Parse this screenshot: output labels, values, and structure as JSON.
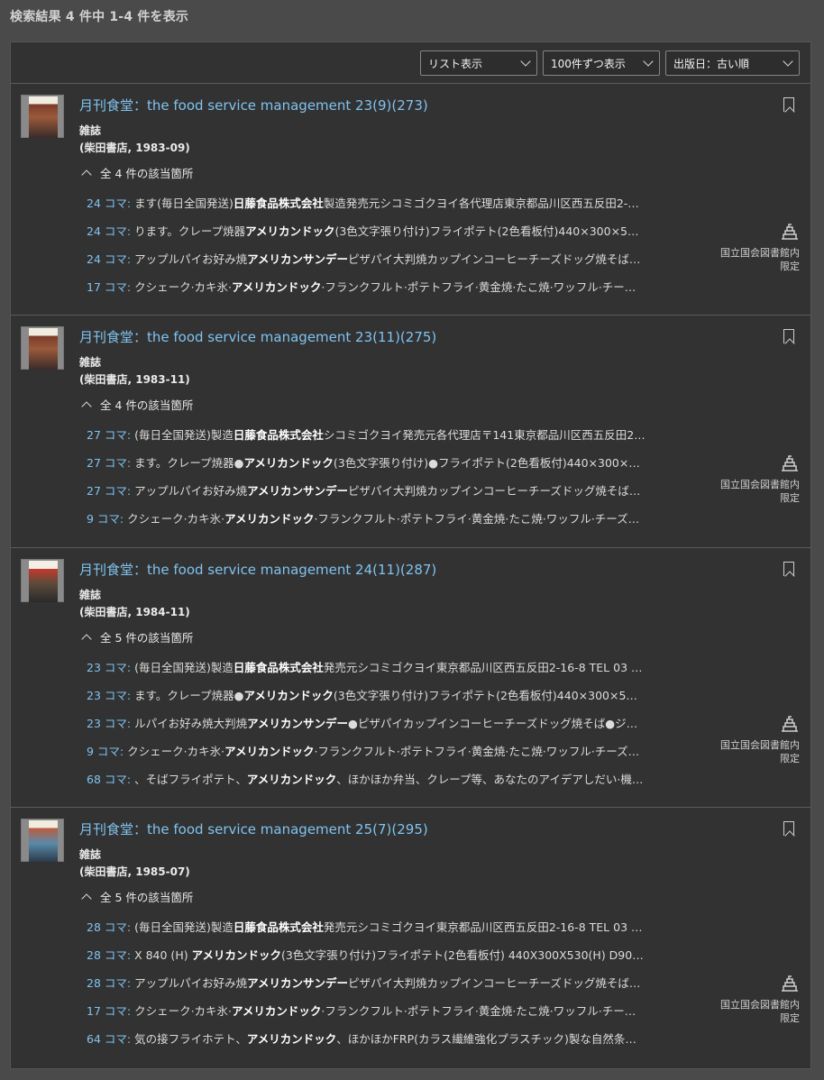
{
  "summary": "検索結果 4 件中 1-4 件を表示",
  "controls": {
    "view": "リスト表示",
    "per_page": "100件ずつ表示",
    "sort": "出版日：古い順"
  },
  "access_label_line1": "国立国会図書館内",
  "access_label_line2": "限定",
  "results": [
    {
      "title": "月刊食堂：the food service management 23(9)(273)",
      "type": "雑誌",
      "publisher": "(柴田書店, 1983-09)",
      "hits_label": "全 4 件の該当箇所",
      "hits": [
        {
          "koma": "24 コマ:",
          "pre": " ます(毎日全国発送)",
          "em": "日藤食品株式会社",
          "post": "製造発売元シコミゴクヨイ各代理店東京都品川区西五反田2-…"
        },
        {
          "koma": "24 コマ:",
          "pre": " ります。クレープ焼器",
          "em": "アメリカンドック",
          "post": "(3色文字張り付け)フライポテト(2色看板付)440×300×5…"
        },
        {
          "koma": "24 コマ:",
          "pre": " アップルパイお好み焼",
          "em": "アメリカンサンデー",
          "post": "ピザパイ大判焼カップインコーヒーチーズドッグ焼そば…"
        },
        {
          "koma": "17 コマ:",
          "pre": " クシェーク·カキ氷·",
          "em": "アメリカンドック",
          "post": "·フランクフルト·ポテトフライ·黄金焼·たこ焼·ワッフル·チー…"
        }
      ]
    },
    {
      "title": "月刊食堂：the food service management 23(11)(275)",
      "type": "雑誌",
      "publisher": "(柴田書店, 1983-11)",
      "hits_label": "全 4 件の該当箇所",
      "hits": [
        {
          "koma": "27 コマ:",
          "pre": " (毎日全国発送)製造",
          "em": "日藤食品株式会社",
          "post": "シコミゴクヨイ発売元各代理店〒141東京都品川区西五反田2…"
        },
        {
          "koma": "27 コマ:",
          "pre": " ます。クレープ焼器●",
          "em": "アメリカンドック",
          "post": "(3色文字張り付け)●フライポテト(2色看板付)440×300×…"
        },
        {
          "koma": "27 コマ:",
          "pre": " アップルパイお好み焼",
          "em": "アメリカンサンデー",
          "post": "ピザパイ大判焼カップインコーヒーチーズドッグ焼そば…"
        },
        {
          "koma": "9 コマ:",
          "pre": " クシェーク·カキ氷·",
          "em": "アメリカンドック",
          "post": "·フランクフルト·ポテトフライ·黄金焼·たこ焼·ワッフル·チーズ…"
        }
      ]
    },
    {
      "title": "月刊食堂：the food service management 24(11)(287)",
      "type": "雑誌",
      "publisher": "(柴田書店, 1984-11)",
      "hits_label": "全 5 件の該当箇所",
      "hits": [
        {
          "koma": "23 コマ:",
          "pre": " (毎日全国発送)製造",
          "em": "日藤食品株式会社",
          "post": "発売元シコミゴクヨイ東京都品川区西五反田2-16-8 TEL 03 …"
        },
        {
          "koma": "23 コマ:",
          "pre": " ます。クレープ焼器●",
          "em": "アメリカンドック",
          "post": "(3色文字張り付け)フライポテト(2色看板付)440×300×5…"
        },
        {
          "koma": "23 コマ:",
          "pre": " ルパイお好み焼大判焼",
          "em": "アメリカンサンデー",
          "post": "●ピザパイカップインコーヒーチーズドッグ焼そば●ジ…"
        },
        {
          "koma": "9 コマ:",
          "pre": " クシェーク·カキ氷·",
          "em": "アメリカンドック",
          "post": "·フランクフルト·ポテトフライ·黄金焼·たこ焼·ワッフル·チーズ…"
        },
        {
          "koma": "68 コマ:",
          "pre": " 、そばフライポテト、",
          "em": "アメリカンドック",
          "post": "、ほかほか弁当、クレープ等、あなたのアイデアしだい·機…"
        }
      ]
    },
    {
      "title": "月刊食堂：the food service management 25(7)(295)",
      "type": "雑誌",
      "publisher": "(柴田書店, 1985-07)",
      "hits_label": "全 5 件の該当箇所",
      "hits": [
        {
          "koma": "28 コマ:",
          "pre": " (毎日全国発送)製造",
          "em": "日藤食品株式会社",
          "post": "発売元シコミゴクヨイ東京都品川区西五反田2-16-8 TEL 03 …"
        },
        {
          "koma": "28 コマ:",
          "pre": " X 840 (H) ",
          "em": "アメリカンドック",
          "post": "(3色文字張り付け)フライポテト(2色看板付) 440X300X530(H) D90…"
        },
        {
          "koma": "28 コマ:",
          "pre": " アップルパイお好み焼",
          "em": "アメリカンサンデー",
          "post": "ピザパイ大判焼カップインコーヒーチーズドッグ焼そば…"
        },
        {
          "koma": "17 コマ:",
          "pre": " クシェーク·カキ氷·",
          "em": "アメリカンドック",
          "post": "·フランクフルト·ポテトフライ·黄金焼·たこ焼·ワッフル·チー…"
        },
        {
          "koma": "64 コマ:",
          "pre": " 気の接フライホテト、",
          "em": "アメリカンドック",
          "post": "、ほかほかFRP(カラス繊維強化プラスチック)製な自然条…"
        }
      ]
    }
  ]
}
